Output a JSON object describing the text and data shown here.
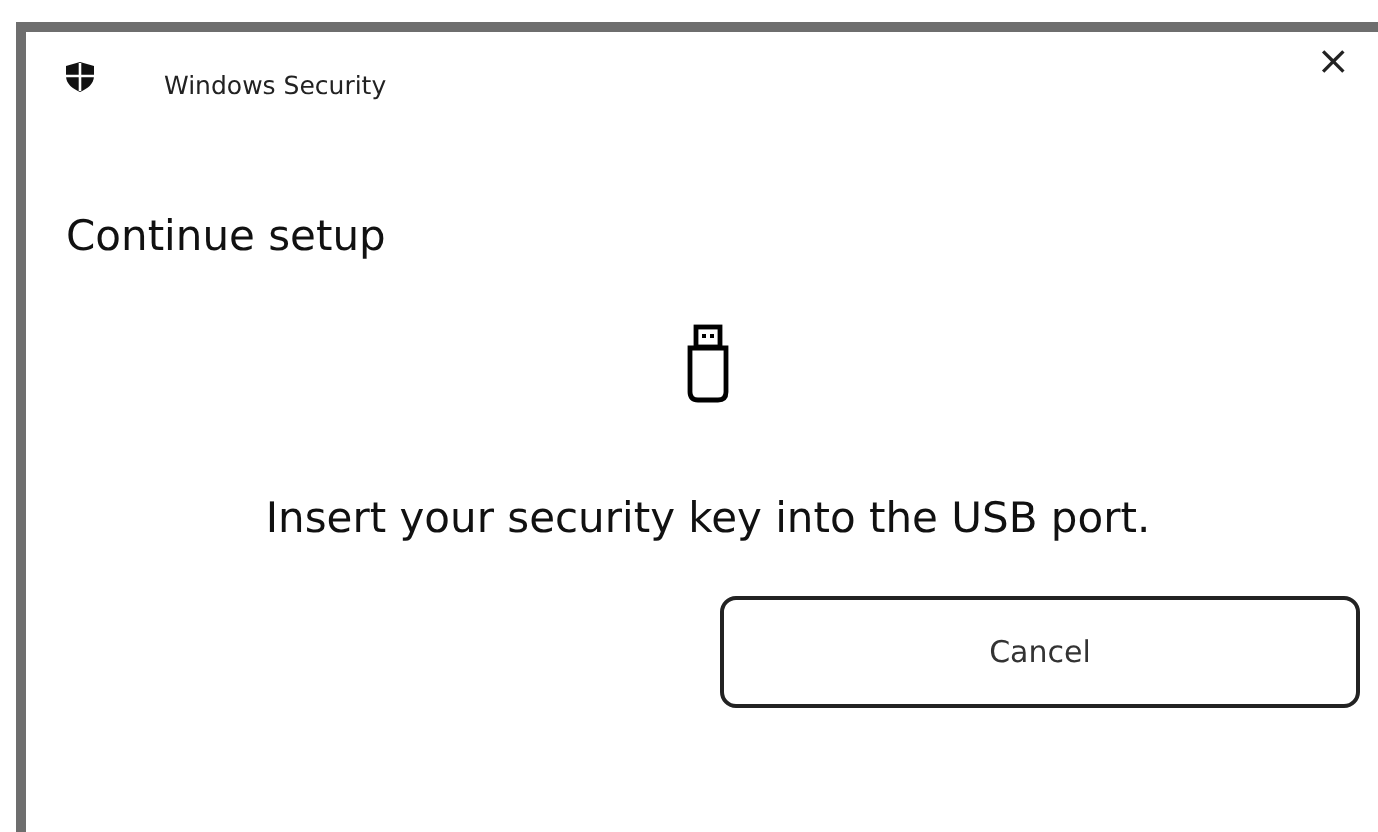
{
  "window": {
    "title": "Windows Security",
    "close": "×"
  },
  "heading": "Continue setup",
  "message": "Insert your security key into the USB port.",
  "buttons": [
    "Cancel"
  ]
}
